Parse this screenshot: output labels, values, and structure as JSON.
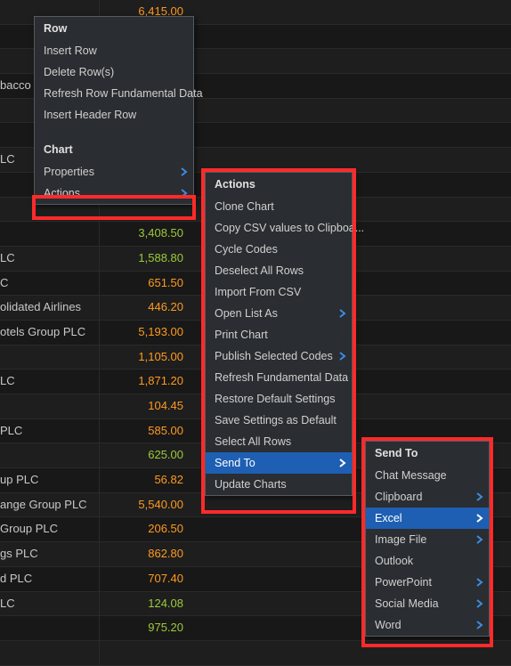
{
  "table": {
    "rows": [
      {
        "name": "",
        "value": "6,415.00",
        "cls": "c-orange"
      },
      {
        "name": "",
        "value": "",
        "cls": ""
      },
      {
        "name": "",
        "value": "",
        "cls": ""
      },
      {
        "name": "bacco",
        "value": "",
        "cls": ""
      },
      {
        "name": "",
        "value": "",
        "cls": ""
      },
      {
        "name": "",
        "value": "",
        "cls": ""
      },
      {
        "name": "LC",
        "value": "",
        "cls": ""
      },
      {
        "name": "",
        "value": "",
        "cls": ""
      },
      {
        "name": "",
        "value": "",
        "cls": ""
      },
      {
        "name": "",
        "value": "3,408.50",
        "cls": "c-green"
      },
      {
        "name": "LC",
        "value": "1,588.80",
        "cls": "c-green"
      },
      {
        "name": "C",
        "value": "651.50",
        "cls": "c-orange"
      },
      {
        "name": "olidated Airlines",
        "value": "446.20",
        "cls": "c-orange"
      },
      {
        "name": "otels Group PLC",
        "value": "5,193.00",
        "cls": "c-orange"
      },
      {
        "name": "",
        "value": "1,105.00",
        "cls": "c-orange"
      },
      {
        "name": "LC",
        "value": "1,871.20",
        "cls": "c-orange"
      },
      {
        "name": "",
        "value": "104.45",
        "cls": "c-orange"
      },
      {
        "name": "PLC",
        "value": "585.00",
        "cls": "c-orange"
      },
      {
        "name": "",
        "value": "625.00",
        "cls": "c-green"
      },
      {
        "name": "up PLC",
        "value": "56.82",
        "cls": "c-orange"
      },
      {
        "name": "ange Group PLC",
        "value": "5,540.00",
        "cls": "c-orange"
      },
      {
        "name": "Group PLC",
        "value": "206.50",
        "cls": "c-orange"
      },
      {
        "name": "gs PLC",
        "value": "862.80",
        "cls": "c-orange"
      },
      {
        "name": "d PLC",
        "value": "707.40",
        "cls": "c-orange"
      },
      {
        "name": "LC",
        "value": "124.08",
        "cls": "c-green"
      },
      {
        "name": "",
        "value": "975.20",
        "cls": "c-green"
      },
      {
        "name": "",
        "value": "",
        "cls": ""
      }
    ]
  },
  "menu1": {
    "sections": [
      {
        "header": "Row",
        "items": [
          {
            "label": "Insert Row",
            "sub": false,
            "hl": false
          },
          {
            "label": "Delete Row(s)",
            "sub": false,
            "hl": false
          },
          {
            "label": "Refresh Row Fundamental Data",
            "sub": false,
            "hl": false
          },
          {
            "label": "Insert Header Row",
            "sub": false,
            "hl": false
          }
        ]
      },
      {
        "header": "Chart",
        "items": [
          {
            "label": "Properties",
            "sub": true,
            "hl": false
          },
          {
            "label": "Actions",
            "sub": true,
            "hl": false
          }
        ]
      }
    ]
  },
  "menu2": {
    "header": "Actions",
    "items": [
      {
        "label": "Clone Chart",
        "sub": false,
        "hl": false
      },
      {
        "label": "Copy CSV values to Clipboa...",
        "sub": false,
        "hl": false
      },
      {
        "label": "Cycle Codes",
        "sub": false,
        "hl": false
      },
      {
        "label": "Deselect All Rows",
        "sub": false,
        "hl": false
      },
      {
        "label": "Import From CSV",
        "sub": false,
        "hl": false
      },
      {
        "label": "Open List As",
        "sub": true,
        "hl": false
      },
      {
        "label": "Print Chart",
        "sub": false,
        "hl": false
      },
      {
        "label": "Publish Selected Codes",
        "sub": true,
        "hl": false
      },
      {
        "label": "Refresh Fundamental Data",
        "sub": false,
        "hl": false
      },
      {
        "label": "Restore Default Settings",
        "sub": false,
        "hl": false
      },
      {
        "label": "Save Settings as Default",
        "sub": false,
        "hl": false
      },
      {
        "label": "Select All Rows",
        "sub": false,
        "hl": false
      },
      {
        "label": "Send To",
        "sub": true,
        "hl": true
      },
      {
        "label": "Update Charts",
        "sub": false,
        "hl": false
      }
    ]
  },
  "menu3": {
    "header": "Send To",
    "items": [
      {
        "label": "Chat Message",
        "sub": false,
        "hl": false
      },
      {
        "label": "Clipboard",
        "sub": true,
        "hl": false
      },
      {
        "label": "Excel",
        "sub": true,
        "hl": true
      },
      {
        "label": "Image File",
        "sub": true,
        "hl": false
      },
      {
        "label": "Outlook",
        "sub": false,
        "hl": false
      },
      {
        "label": "PowerPoint",
        "sub": true,
        "hl": false
      },
      {
        "label": "Social Media",
        "sub": true,
        "hl": false
      },
      {
        "label": "Word",
        "sub": true,
        "hl": false
      }
    ]
  }
}
